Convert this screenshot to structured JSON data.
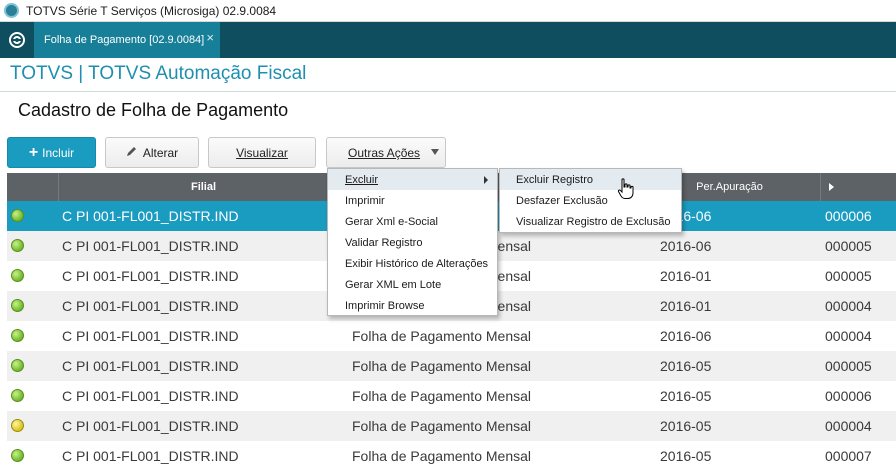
{
  "window": {
    "title": "TOTVS Série T Serviços (Microsiga) 02.9.0084"
  },
  "tabs": [
    {
      "label": "Folha de Pagamento [02.9.0084]",
      "close": "×"
    }
  ],
  "brand": "TOTVS | TOTVS Automação Fiscal",
  "page": {
    "title": "Cadastro de Folha de Pagamento"
  },
  "toolbar": {
    "incluir": "Incluir",
    "alterar": "Alterar",
    "visualizar": "Visualizar",
    "outras_acoes": "Outras Ações"
  },
  "grid": {
    "columns": [
      "",
      "Filial",
      "",
      "Per.Apuração",
      ""
    ],
    "rows": [
      {
        "status": "green",
        "filial": "C PI 001-FL001_DISTR.IND",
        "tipo": "",
        "periodo": "2016-06",
        "recibo": "000006",
        "selected": true
      },
      {
        "status": "green",
        "filial": "C PI 001-FL001_DISTR.IND",
        "tipo": "Folha de Pagamento Mensal",
        "periodo": "2016-06",
        "recibo": "000005"
      },
      {
        "status": "green",
        "filial": "C PI 001-FL001_DISTR.IND",
        "tipo": "Folha de Pagamento Mensal",
        "periodo": "2016-01",
        "recibo": "000005"
      },
      {
        "status": "green",
        "filial": "C PI 001-FL001_DISTR.IND",
        "tipo": "Folha de Pagamento Mensal",
        "periodo": "2016-01",
        "recibo": "000004"
      },
      {
        "status": "green",
        "filial": "C PI 001-FL001_DISTR.IND",
        "tipo": "Folha de Pagamento Mensal",
        "periodo": "2016-06",
        "recibo": "000004"
      },
      {
        "status": "green",
        "filial": "C PI 001-FL001_DISTR.IND",
        "tipo": "Folha de Pagamento Mensal",
        "periodo": "2016-05",
        "recibo": "000005"
      },
      {
        "status": "green",
        "filial": "C PI 001-FL001_DISTR.IND",
        "tipo": "Folha de Pagamento Mensal",
        "periodo": "2016-05",
        "recibo": "000006"
      },
      {
        "status": "yellow",
        "filial": "C PI 001-FL001_DISTR.IND",
        "tipo": "Folha de Pagamento Mensal",
        "periodo": "2016-05",
        "recibo": "000004"
      },
      {
        "status": "green",
        "filial": "C PI 001-FL001_DISTR.IND",
        "tipo": "Folha de Pagamento Mensal",
        "periodo": "2016-05",
        "recibo": "000007"
      }
    ]
  },
  "menu": {
    "items": [
      "Excluir",
      "Imprimir",
      "Gerar Xml e-Social",
      "Validar Registro",
      "Exibir Histórico de Alterações",
      "Gerar XML em Lote",
      "Imprimir Browse"
    ]
  },
  "submenu": {
    "items": [
      "Excluir Registro",
      "Desfazer Exclusão",
      "Visualizar Registro de Exclusão"
    ]
  },
  "colors": {
    "tabbar": "#0f4e5e",
    "accent": "#1a9bc0",
    "grid_header": "#5d6266",
    "status_ok": "#6db82a",
    "status_warn": "#d8c21a"
  }
}
